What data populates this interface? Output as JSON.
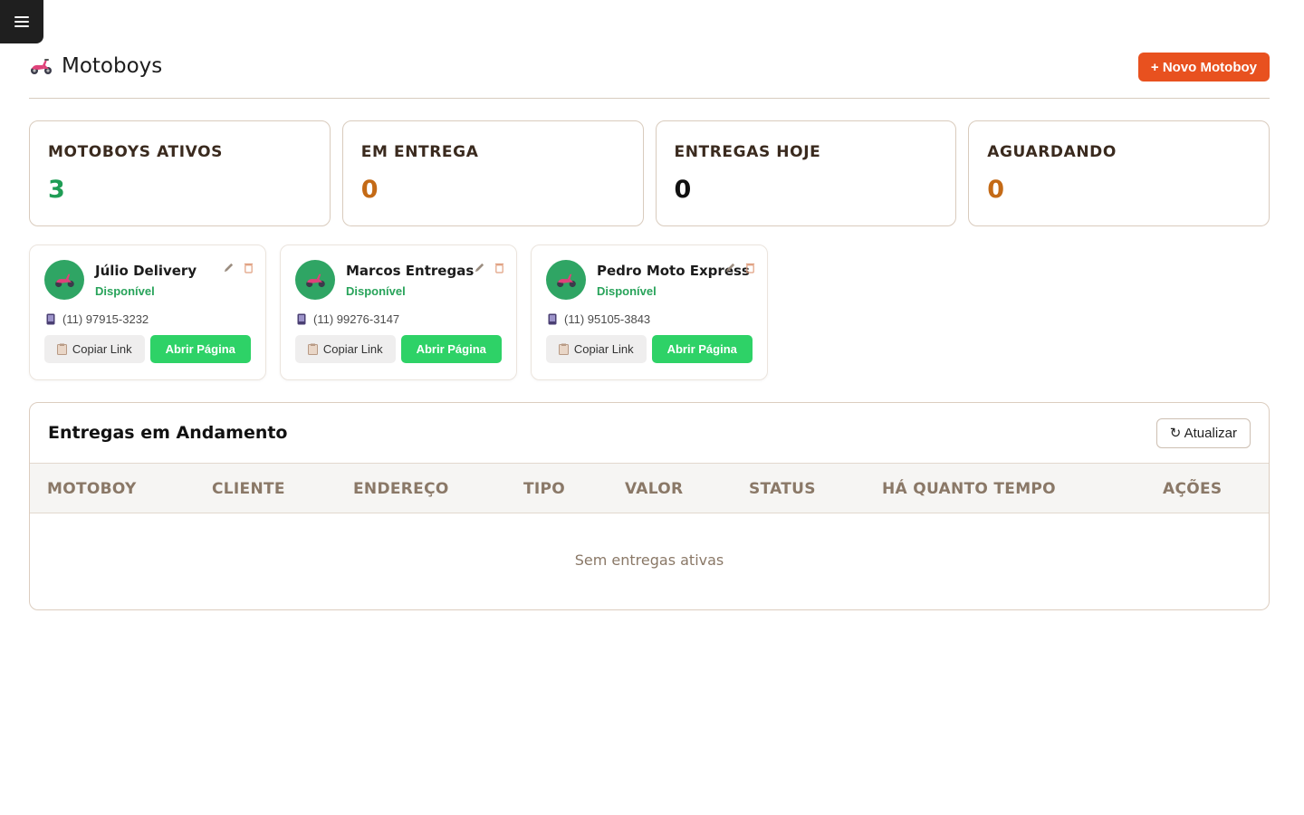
{
  "nav": {
    "menu_icon": "hamburger-icon"
  },
  "header": {
    "title": "Motoboys",
    "title_icon": "scooter-icon",
    "new_button": "+ Novo Motoboy"
  },
  "stats": [
    {
      "label": "MOTOBOYS ATIVOS",
      "value": "3",
      "color": "#1f9d55"
    },
    {
      "label": "EM ENTREGA",
      "value": "0",
      "color": "#c46a16"
    },
    {
      "label": "ENTREGAS HOJE",
      "value": "0",
      "color": "#111111"
    },
    {
      "label": "AGUARDANDO",
      "value": "0",
      "color": "#c46a16"
    }
  ],
  "couriers": [
    {
      "name": "Júlio Delivery",
      "status": "Disponível",
      "phone": "(11) 97915-3232",
      "copy_label": "Copiar Link",
      "open_label": "Abrir Página"
    },
    {
      "name": "Marcos Entregas",
      "status": "Disponível",
      "phone": "(11) 99276-3147",
      "copy_label": "Copiar Link",
      "open_label": "Abrir Página"
    },
    {
      "name": "Pedro Moto Express",
      "status": "Disponível",
      "phone": "(11) 95105-3843",
      "copy_label": "Copiar Link",
      "open_label": "Abrir Página"
    }
  ],
  "deliveries": {
    "title": "Entregas em Andamento",
    "refresh_label": "↻ Atualizar",
    "columns": [
      "MOTOBOY",
      "CLIENTE",
      "ENDEREÇO",
      "TIPO",
      "VALOR",
      "STATUS",
      "HÁ QUANTO TEMPO",
      "AÇÕES"
    ],
    "empty_text": "Sem entregas ativas"
  },
  "colors": {
    "accent": "#e8511f",
    "success": "#2ed267",
    "available": "#28a35a"
  }
}
